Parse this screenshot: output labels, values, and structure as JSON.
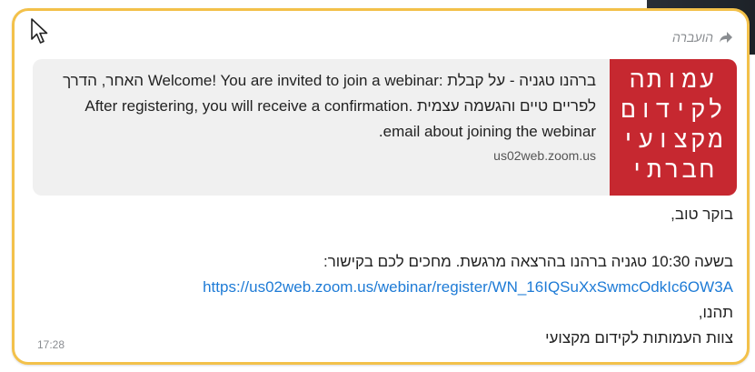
{
  "message": {
    "forwarded_label": "הועברה",
    "link_preview": {
      "text": "ברהנו טגניה - על קבלת :Welcome! You are invited to join a webinar האחר, הדרך לפריים טיים והגשמה עצמית .After registering, you will receive a confirmation email about joining the webinar.",
      "domain": "us02web.zoom.us",
      "logo_lines": [
        "עמותה",
        "לקידום",
        "מקצועי",
        "חברתי"
      ],
      "logo_color": "#c62830"
    },
    "greeting": "בוקר טוב,",
    "announcement": "בשעה 10:30 טגניה ברהנו בהרצאה מרגשת. מחכים לכם בקישור:",
    "link": "https://us02web.zoom.us/webinar/register/WN_16IQSuXxSwmcOdkIc6OW3A",
    "signoff": "תהנו,",
    "signature": "צוות העמותות לקידום מקצועי",
    "time": "17:28"
  },
  "colors": {
    "bubble_border": "#f3c14a",
    "link": "#1e7bd6",
    "preview_bg": "#f0f0f0"
  }
}
